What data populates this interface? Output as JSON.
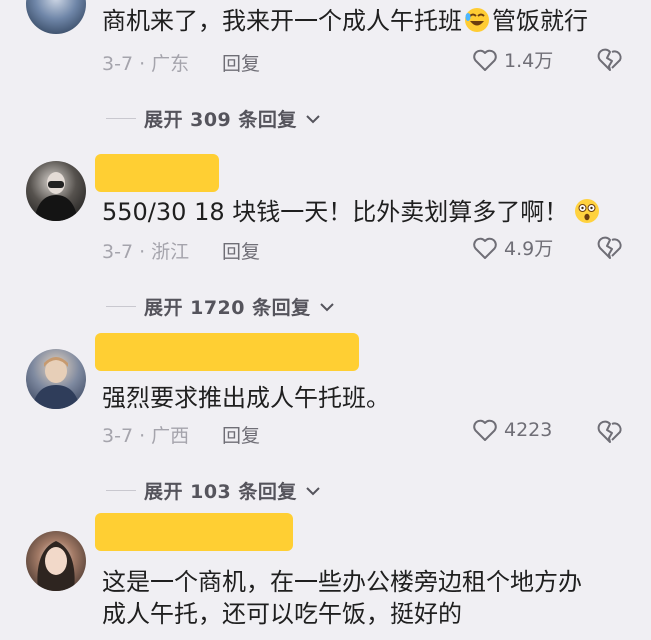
{
  "comments": [
    {
      "content_a": "商机来了，我来开一个成人午托班",
      "content_b": "管饭就行",
      "emoji": "rolling-laughing-emoji",
      "meta": "3-7 · 广东",
      "reply": "回复",
      "likes": "1.4万",
      "expand": "展开 309 条回复"
    },
    {
      "content": "550/30  18 块钱一天！比外卖划算多了啊！",
      "emoji": "shocked-emoji",
      "meta": "3-7 · 浙江",
      "reply": "回复",
      "likes": "4.9万",
      "expand": "展开 1720 条回复"
    },
    {
      "content": "强烈要求推出成人午托班。",
      "meta": "3-7 · 广西",
      "reply": "回复",
      "likes": "4223",
      "expand": "展开 103 条回复"
    },
    {
      "line1": "这是一个商机，在一些办公楼旁边租个地方办",
      "line2": "成人午托，还可以吃午饭，挺好的"
    }
  ],
  "colors": {
    "background": "#f0eff3",
    "name_highlight": "#ffcf33",
    "meta_text": "#a5a4ac",
    "action_text": "#6f6e76"
  },
  "icons": [
    "heart-icon",
    "broken-heart-icon",
    "chevron-down-icon"
  ]
}
